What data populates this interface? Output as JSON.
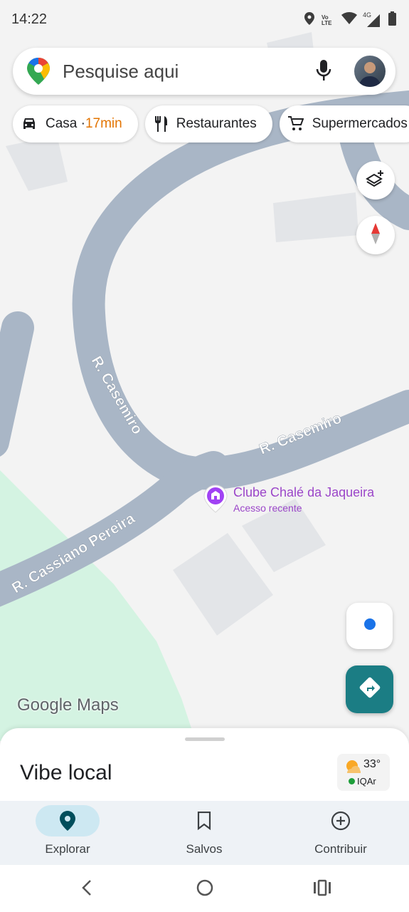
{
  "status_bar": {
    "time": "14:22",
    "icons": [
      "location-icon",
      "volte-icon",
      "wifi-icon",
      "4g-signal-icon",
      "battery-icon"
    ],
    "network_label": "4G",
    "volte_label": "Vo LTE"
  },
  "search": {
    "placeholder": "Pesquise aqui"
  },
  "chips": [
    {
      "label": "Casa · ",
      "eta": "17min",
      "icon": "car-icon"
    },
    {
      "label": "Restaurantes",
      "icon": "fork-knife-icon"
    },
    {
      "label": "Supermercados",
      "icon": "cart-icon"
    }
  ],
  "map": {
    "streets": [
      "R. Casemiro",
      "R. Casemiro",
      "R. Cassiano Pereira"
    ],
    "poi": {
      "name": "Clube Chalé da Jaqueira",
      "subtitle": "Acesso recente",
      "icon": "poi-pin-icon"
    },
    "watermark": "Google Maps",
    "colors": {
      "road": "#a9b6c6",
      "park": "#d4f3e2",
      "building": "#e3e5e8",
      "poi": "#9b46c9",
      "accent": "#1b7d84"
    }
  },
  "sheet": {
    "title": "Vibe local",
    "weather": {
      "temperature": "33°",
      "aqi": "IQAr",
      "icon": "partly-sunny-icon"
    }
  },
  "bottom_nav": [
    {
      "label": "Explorar",
      "icon": "explore-pin-icon",
      "active": true
    },
    {
      "label": "Salvos",
      "icon": "bookmark-icon",
      "active": false
    },
    {
      "label": "Contribuir",
      "icon": "add-circle-icon",
      "active": false
    }
  ],
  "system_nav": [
    "back-icon",
    "home-icon",
    "recents-icon"
  ]
}
